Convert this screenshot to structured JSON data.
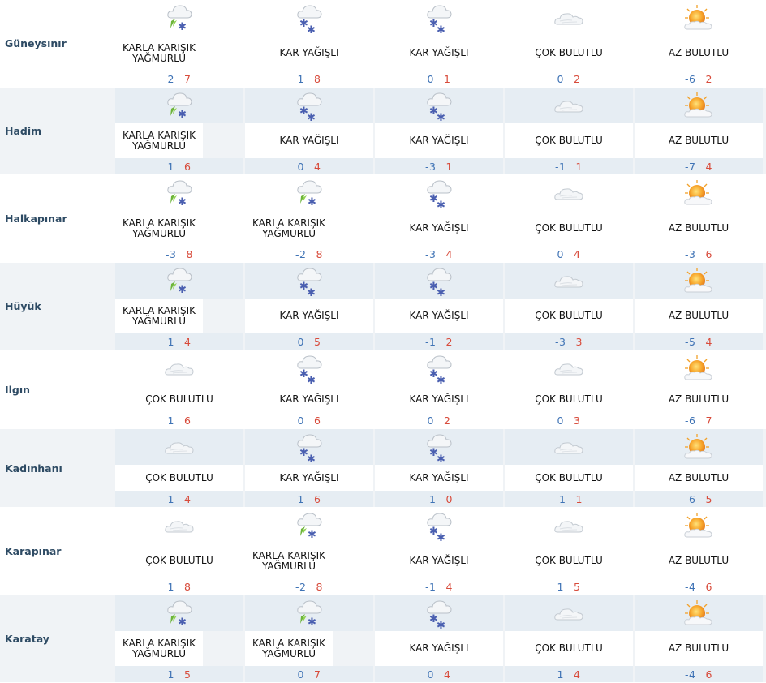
{
  "forecast": [
    {
      "city": "Güneysınır",
      "days": [
        {
          "icon": "sleet-icon",
          "desc": "KARLA KARIŞIK YAĞMURLU",
          "low": "2",
          "high": "7"
        },
        {
          "icon": "snow-icon",
          "desc": "KAR YAĞIŞLI",
          "low": "1",
          "high": "8"
        },
        {
          "icon": "snow-icon",
          "desc": "KAR YAĞIŞLI",
          "low": "0",
          "high": "1"
        },
        {
          "icon": "cloudy-icon",
          "desc": "ÇOK BULUTLU",
          "low": "0",
          "high": "2"
        },
        {
          "icon": "partly-cloudy-icon",
          "desc": "AZ BULUTLU",
          "low": "-6",
          "high": "2"
        }
      ]
    },
    {
      "city": "Hadim",
      "days": [
        {
          "icon": "sleet-icon",
          "desc": "KARLA KARIŞIK YAĞMURLU",
          "low": "1",
          "high": "6"
        },
        {
          "icon": "snow-icon",
          "desc": "KAR YAĞIŞLI",
          "low": "0",
          "high": "4"
        },
        {
          "icon": "snow-icon",
          "desc": "KAR YAĞIŞLI",
          "low": "-3",
          "high": "1"
        },
        {
          "icon": "cloudy-icon",
          "desc": "ÇOK BULUTLU",
          "low": "-1",
          "high": "1"
        },
        {
          "icon": "partly-cloudy-icon",
          "desc": "AZ BULUTLU",
          "low": "-7",
          "high": "4"
        }
      ]
    },
    {
      "city": "Halkapınar",
      "days": [
        {
          "icon": "sleet-icon",
          "desc": "KARLA KARIŞIK YAĞMURLU",
          "low": "-3",
          "high": "8"
        },
        {
          "icon": "sleet-icon",
          "desc": "KARLA KARIŞIK YAĞMURLU",
          "low": "-2",
          "high": "8"
        },
        {
          "icon": "snow-icon",
          "desc": "KAR YAĞIŞLI",
          "low": "-3",
          "high": "4"
        },
        {
          "icon": "cloudy-icon",
          "desc": "ÇOK BULUTLU",
          "low": "0",
          "high": "4"
        },
        {
          "icon": "partly-cloudy-icon",
          "desc": "AZ BULUTLU",
          "low": "-3",
          "high": "6"
        }
      ]
    },
    {
      "city": "Hüyük",
      "days": [
        {
          "icon": "sleet-icon",
          "desc": "KARLA KARIŞIK YAĞMURLU",
          "low": "1",
          "high": "4"
        },
        {
          "icon": "snow-icon",
          "desc": "KAR YAĞIŞLI",
          "low": "0",
          "high": "5"
        },
        {
          "icon": "snow-icon",
          "desc": "KAR YAĞIŞLI",
          "low": "-1",
          "high": "2"
        },
        {
          "icon": "cloudy-icon",
          "desc": "ÇOK BULUTLU",
          "low": "-3",
          "high": "3"
        },
        {
          "icon": "partly-cloudy-icon",
          "desc": "AZ BULUTLU",
          "low": "-5",
          "high": "4"
        }
      ]
    },
    {
      "city": "Ilgın",
      "days": [
        {
          "icon": "cloudy-icon",
          "desc": "ÇOK BULUTLU",
          "low": "1",
          "high": "6"
        },
        {
          "icon": "snow-icon",
          "desc": "KAR YAĞIŞLI",
          "low": "0",
          "high": "6"
        },
        {
          "icon": "snow-icon",
          "desc": "KAR YAĞIŞLI",
          "low": "0",
          "high": "2"
        },
        {
          "icon": "cloudy-icon",
          "desc": "ÇOK BULUTLU",
          "low": "0",
          "high": "3"
        },
        {
          "icon": "partly-cloudy-icon",
          "desc": "AZ BULUTLU",
          "low": "-6",
          "high": "7"
        }
      ]
    },
    {
      "city": "Kadınhanı",
      "days": [
        {
          "icon": "cloudy-icon",
          "desc": "ÇOK BULUTLU",
          "low": "1",
          "high": "4"
        },
        {
          "icon": "snow-icon",
          "desc": "KAR YAĞIŞLI",
          "low": "1",
          "high": "6"
        },
        {
          "icon": "snow-icon",
          "desc": "KAR YAĞIŞLI",
          "low": "-1",
          "high": "0"
        },
        {
          "icon": "cloudy-icon",
          "desc": "ÇOK BULUTLU",
          "low": "-1",
          "high": "1"
        },
        {
          "icon": "partly-cloudy-icon",
          "desc": "AZ BULUTLU",
          "low": "-6",
          "high": "5"
        }
      ]
    },
    {
      "city": "Karapınar",
      "days": [
        {
          "icon": "cloudy-icon",
          "desc": "ÇOK BULUTLU",
          "low": "1",
          "high": "8"
        },
        {
          "icon": "sleet-icon",
          "desc": "KARLA KARIŞIK YAĞMURLU",
          "low": "-2",
          "high": "8"
        },
        {
          "icon": "snow-icon",
          "desc": "KAR YAĞIŞLI",
          "low": "-1",
          "high": "4"
        },
        {
          "icon": "cloudy-icon",
          "desc": "ÇOK BULUTLU",
          "low": "1",
          "high": "5"
        },
        {
          "icon": "partly-cloudy-icon",
          "desc": "AZ BULUTLU",
          "low": "-4",
          "high": "6"
        }
      ]
    },
    {
      "city": "Karatay",
      "days": [
        {
          "icon": "sleet-icon",
          "desc": "KARLA KARIŞIK YAĞMURLU",
          "low": "1",
          "high": "5"
        },
        {
          "icon": "sleet-icon",
          "desc": "KARLA KARIŞIK YAĞMURLU",
          "low": "0",
          "high": "7"
        },
        {
          "icon": "snow-icon",
          "desc": "KAR YAĞIŞLI",
          "low": "0",
          "high": "4"
        },
        {
          "icon": "cloudy-icon",
          "desc": "ÇOK BULUTLU",
          "low": "1",
          "high": "4"
        },
        {
          "icon": "partly-cloudy-icon",
          "desc": "AZ BULUTLU",
          "low": "-4",
          "high": "6"
        }
      ]
    }
  ],
  "colors": {
    "low": "#3f73b5",
    "high": "#d84b3b",
    "city": "#2e4b64"
  }
}
